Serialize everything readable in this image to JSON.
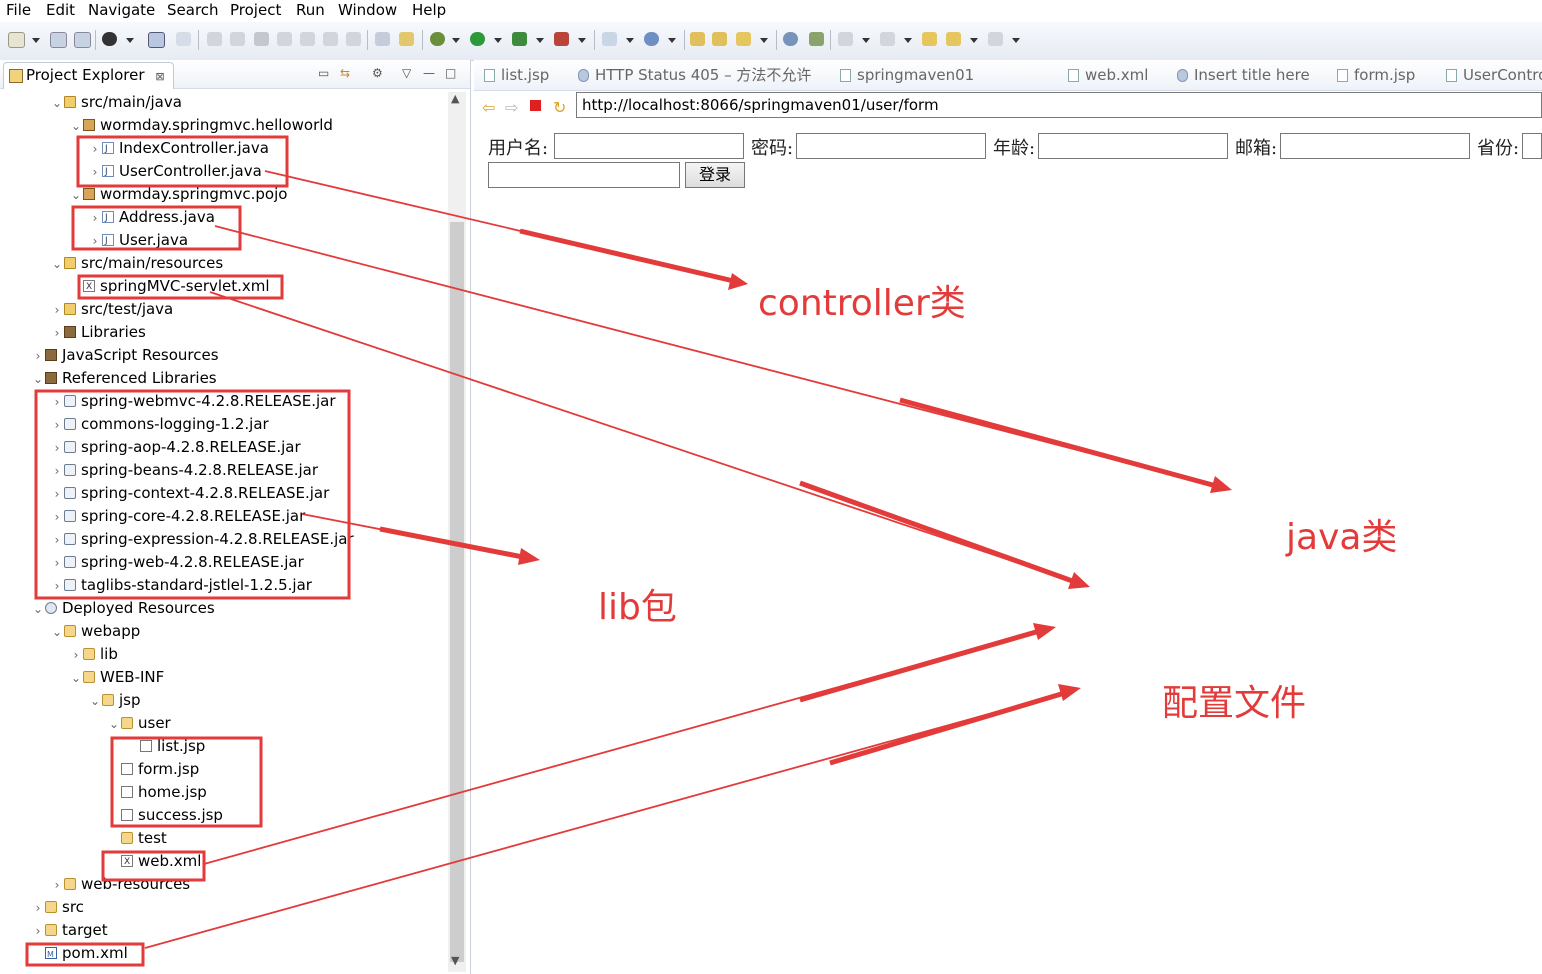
{
  "menu": [
    "File",
    "Edit",
    "Navigate",
    "Search",
    "Project",
    "Run",
    "Window",
    "Help"
  ],
  "explorer": {
    "title": "Project Explorer",
    "close_glyph": "⊠",
    "tree": [
      {
        "label": "src/main/java",
        "icon": "package-folder-icon",
        "expanded": true
      },
      {
        "label": "wormday.springmvc.helloworld",
        "icon": "package-icon",
        "expanded": true
      },
      {
        "label": "IndexController.java",
        "icon": "java-file-icon",
        "expanded": false
      },
      {
        "label": "UserController.java",
        "icon": "java-file-icon",
        "expanded": false
      },
      {
        "label": "wormday.springmvc.pojo",
        "icon": "package-icon",
        "expanded": true
      },
      {
        "label": "Address.java",
        "icon": "java-file-icon",
        "expanded": false
      },
      {
        "label": "User.java",
        "icon": "java-file-icon",
        "expanded": false
      },
      {
        "label": "src/main/resources",
        "icon": "package-folder-icon",
        "expanded": true
      },
      {
        "label": "springMVC-servlet.xml",
        "icon": "xml-file-icon"
      },
      {
        "label": "src/test/java",
        "icon": "package-folder-icon",
        "expanded": false
      },
      {
        "label": "Libraries",
        "icon": "library-icon",
        "expanded": false
      },
      {
        "label": "JavaScript Resources",
        "icon": "library-icon",
        "expanded": false
      },
      {
        "label": "Referenced Libraries",
        "icon": "library-icon",
        "expanded": true
      },
      {
        "label": "spring-webmvc-4.2.8.RELEASE.jar",
        "icon": "jar-icon",
        "expanded": false
      },
      {
        "label": "commons-logging-1.2.jar",
        "icon": "jar-icon",
        "expanded": false
      },
      {
        "label": "spring-aop-4.2.8.RELEASE.jar",
        "icon": "jar-icon",
        "expanded": false
      },
      {
        "label": "spring-beans-4.2.8.RELEASE.jar",
        "icon": "jar-icon",
        "expanded": false
      },
      {
        "label": "spring-context-4.2.8.RELEASE.jar",
        "icon": "jar-icon",
        "expanded": false
      },
      {
        "label": "spring-core-4.2.8.RELEASE.jar",
        "icon": "jar-icon",
        "expanded": false
      },
      {
        "label": "spring-expression-4.2.8.RELEASE.jar",
        "icon": "jar-icon",
        "expanded": false
      },
      {
        "label": "spring-web-4.2.8.RELEASE.jar",
        "icon": "jar-icon",
        "expanded": false
      },
      {
        "label": "taglibs-standard-jstlel-1.2.5.jar",
        "icon": "jar-icon",
        "expanded": false
      },
      {
        "label": "Deployed Resources",
        "icon": "deployed-resources-icon",
        "expanded": true
      },
      {
        "label": "webapp",
        "icon": "folder-icon",
        "expanded": true
      },
      {
        "label": "lib",
        "icon": "folder-icon",
        "expanded": false
      },
      {
        "label": "WEB-INF",
        "icon": "folder-icon",
        "expanded": true
      },
      {
        "label": "jsp",
        "icon": "folder-icon",
        "expanded": true
      },
      {
        "label": "user",
        "icon": "folder-icon",
        "expanded": true
      },
      {
        "label": "list.jsp",
        "icon": "jsp-file-icon"
      },
      {
        "label": "form.jsp",
        "icon": "jsp-file-icon"
      },
      {
        "label": "home.jsp",
        "icon": "jsp-file-icon"
      },
      {
        "label": "success.jsp",
        "icon": "jsp-file-icon"
      },
      {
        "label": "test",
        "icon": "folder-icon"
      },
      {
        "label": "web.xml",
        "icon": "xml-file-icon"
      },
      {
        "label": "web-resources",
        "icon": "folder-icon",
        "expanded": false
      },
      {
        "label": "src",
        "icon": "folder-icon",
        "expanded": false
      },
      {
        "label": "target",
        "icon": "folder-icon",
        "expanded": false
      },
      {
        "label": "pom.xml",
        "icon": "maven-pom-icon"
      }
    ]
  },
  "editor_tabs": [
    {
      "label": "list.jsp",
      "icon": "jsp-file-icon"
    },
    {
      "label": "HTTP Status 405 – 方法不允许",
      "icon": "browser-globe-icon"
    },
    {
      "label": "springmaven01",
      "icon": "maven-pom-icon"
    },
    {
      "label": "web.xml",
      "icon": "xml-file-icon"
    },
    {
      "label": "Insert title here",
      "icon": "browser-globe-icon"
    },
    {
      "label": "form.jsp",
      "icon": "jsp-file-icon"
    },
    {
      "label": "UserContro",
      "icon": "java-file-icon"
    }
  ],
  "browser": {
    "url": "http://localhost:8066/springmaven01/user/form",
    "form": {
      "labels": [
        "用户名:",
        "密码:",
        "年龄:",
        "邮箱:",
        "省份:"
      ],
      "submit_label": "登录"
    }
  },
  "annotations": {
    "controller": "controller类",
    "java": "java类",
    "lib": "lib包",
    "config": "配置文件",
    "color": "#e33a3a"
  }
}
